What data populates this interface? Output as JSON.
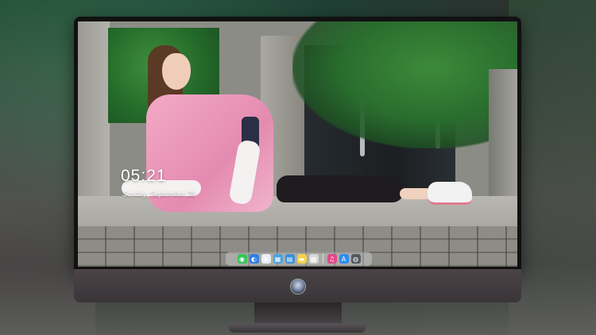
{
  "lockscreen": {
    "time": "05:21",
    "date": "Sunday, September 28"
  },
  "dock": {
    "items": [
      {
        "name": "messages-icon",
        "glyph": "◉",
        "color": "#34c759"
      },
      {
        "name": "finder-icon",
        "glyph": "◐",
        "color": "#2f7de1"
      },
      {
        "name": "safari-icon",
        "glyph": "⊕",
        "color": "#e9eef5"
      },
      {
        "name": "preview-icon",
        "glyph": "▦",
        "color": "#4aa3df"
      },
      {
        "name": "claquette-icon",
        "glyph": "▤",
        "color": "#3a8fd9"
      },
      {
        "name": "notes-icon",
        "glyph": "▬",
        "color": "#f5d14b"
      },
      {
        "name": "photos-icon",
        "glyph": "▩",
        "color": "#d6d6d6"
      },
      {
        "name": "music-icon",
        "glyph": "♫",
        "color": "#e0478a"
      },
      {
        "name": "app-store-icon",
        "glyph": "A",
        "color": "#2d8cf0"
      },
      {
        "name": "camera-icon",
        "glyph": "◍",
        "color": "#555a60"
      }
    ]
  }
}
